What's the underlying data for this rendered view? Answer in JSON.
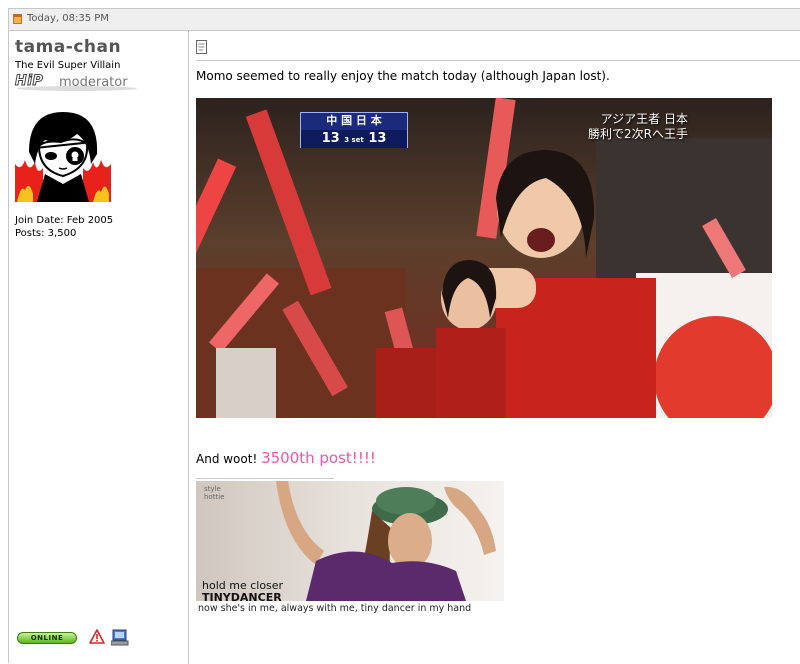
{
  "post": {
    "date": "Today, 08:35 PM"
  },
  "user": {
    "name": "tama-chan",
    "title": "The Evil Super Villain",
    "rank_brand": "HiP",
    "rank_role": "moderator",
    "join_date": "Join Date: Feb 2005",
    "posts": "Posts: 3,500",
    "status_badge": "ONLINE"
  },
  "message": {
    "line1": "Momo seemed to really enjoy the match today (although Japan lost).",
    "line2_prefix": "And woot! ",
    "line2_highlight": "3500th post!!!!",
    "highlight_color": "#ee55aa"
  },
  "photo": {
    "score_header": "中 国 日 本",
    "score_left": "13",
    "score_set": "3 set",
    "score_right": "13",
    "caption_line1": "アジア王者 日本",
    "caption_line2": "勝利で2次Rへ王手"
  },
  "signature": {
    "credit_line1": "style",
    "credit_line2": "hottie",
    "text_line1": "hold me closer",
    "text_line2": "TINYDANCER",
    "caption": "now she's in me, always with me, tiny dancer in my hand"
  },
  "icons": {
    "date": "post-date-icon",
    "post": "post-icon",
    "report": "report-icon",
    "ip": "ip-address-icon"
  },
  "colors": {
    "border": "#c8c8c8",
    "header_bg": "#efefef",
    "username": "#555555",
    "online_green": "#5fb51e"
  }
}
